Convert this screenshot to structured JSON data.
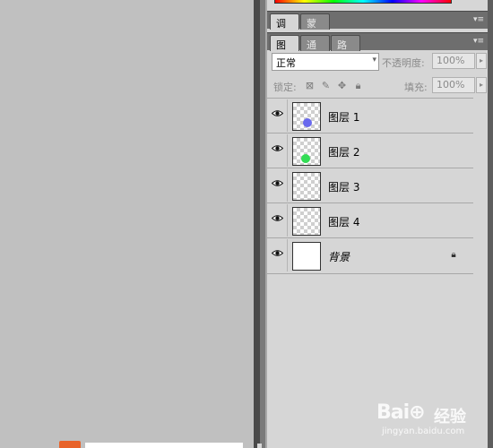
{
  "top_panel": {
    "tabs": [
      {
        "label": "调整",
        "active": true
      },
      {
        "label": "蒙版",
        "active": false
      }
    ],
    "menu_icon": "panel-menu-icon"
  },
  "layers_panel": {
    "tabs": [
      {
        "label": "图层",
        "active": true
      },
      {
        "label": "通道",
        "active": false
      },
      {
        "label": "路径",
        "active": false
      }
    ],
    "blend_mode": "正常",
    "opacity_label": "不透明度:",
    "opacity_value": "100%",
    "lock_label": "锁定:",
    "fill_label": "填充:",
    "fill_value": "100%",
    "lock_icons": [
      "lock-transparent-icon",
      "lock-paint-icon",
      "lock-move-icon",
      "lock-all-icon"
    ],
    "layers": [
      {
        "name": "图层 1",
        "visible": true,
        "thumb_color": "#6a6aee"
      },
      {
        "name": "图层 2",
        "visible": true,
        "thumb_color": "#33dd55"
      },
      {
        "name": "图层 3",
        "visible": true
      },
      {
        "name": "图层 4",
        "visible": true
      },
      {
        "name": "背景",
        "visible": true,
        "locked": true,
        "background": true
      }
    ]
  },
  "watermark": {
    "brand": "Bai⊕",
    "product": "经验",
    "url": "jingyan.baidu.com"
  }
}
